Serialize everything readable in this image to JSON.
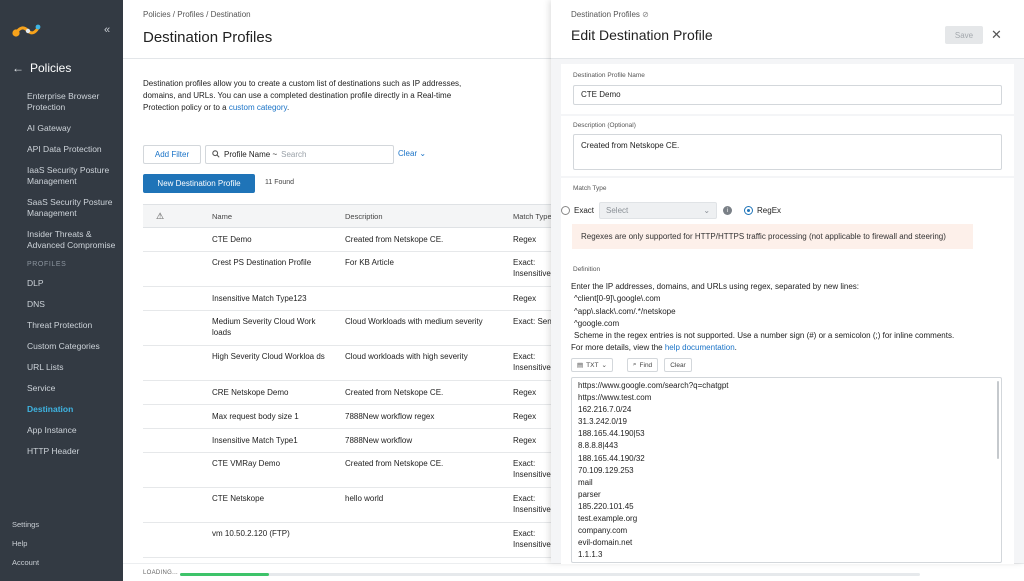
{
  "sidebar": {
    "back_title": "Policies",
    "items": [
      "Enterprise Browser Protection",
      "AI Gateway",
      "API Data Protection",
      "IaaS Security Posture Management",
      "SaaS Security Posture Management",
      "Insider Threats & Advanced Compromise"
    ],
    "section_label": "PROFILES",
    "profiles": [
      "DLP",
      "DNS",
      "Threat Protection",
      "Custom Categories",
      "URL Lists",
      "Service",
      "Destination",
      "App Instance",
      "HTTP Header"
    ],
    "active": "Destination",
    "bottom": [
      "Settings",
      "Help",
      "Account"
    ]
  },
  "main": {
    "breadcrumb": "Policies / Profiles / Destination",
    "title": "Destination Profiles",
    "intro_text": "Destination profiles allow you to create a custom list of destinations such as IP addresses, domains, and URLs. You can use a completed destination profile directly in a Real-time Protection policy or to a ",
    "intro_link": "custom category",
    "intro_end": ".",
    "add_filter": "Add Filter",
    "filter_label": "Profile Name ~",
    "filter_placeholder": "Search",
    "clear": "Clear",
    "new_button": "New Destination Profile",
    "found": "11 Found",
    "columns": {
      "warn": "⚠",
      "name": "Name",
      "description": "Description",
      "match": "Match Type"
    },
    "rows": [
      {
        "name": "CTE Demo",
        "desc": "Created from Netskope CE.",
        "match": "Regex"
      },
      {
        "name": "Crest PS Destination Profile",
        "desc": "For KB Article",
        "match": "Exact: Insensitive"
      },
      {
        "name": "Insensitive Match Type123",
        "desc": "",
        "match": "Regex"
      },
      {
        "name": "Medium Severity Cloud Work loads",
        "desc": "Cloud Workloads with medium severity",
        "match": "Exact: Sensitive"
      },
      {
        "name": "High Severity Cloud Workloa ds",
        "desc": "Cloud workloads with high severity",
        "match": "Exact: Insensitive"
      },
      {
        "name": "CRE Netskope Demo",
        "desc": "Created from Netskope CE.",
        "match": "Regex"
      },
      {
        "name": "Max request body size 1",
        "desc": "7888New workflow regex",
        "match": "Regex"
      },
      {
        "name": "Insensitive Match Type1",
        "desc": "7888New workflow",
        "match": "Regex"
      },
      {
        "name": "CTE VMRay Demo",
        "desc": "Created from Netskope CE.",
        "match": "Exact: Insensitive"
      },
      {
        "name": "CTE Netskope",
        "desc": "hello world",
        "match": "Exact: Insensitive"
      },
      {
        "name": "vm 10.50.2.120 (FTP)",
        "desc": "",
        "match": "Exact: Insensitive"
      }
    ]
  },
  "loading": {
    "label": "LOADING...",
    "progress": 0.12
  },
  "panel": {
    "breadcrumb": "Destination Profiles",
    "title": "Edit Destination Profile",
    "save": "Save",
    "name_label": "Destination Profile Name",
    "name_value": "CTE Demo",
    "desc_label": "Description (Optional)",
    "desc_value": "Created from Netskope CE.",
    "match_label": "Match Type",
    "exact_label": "Exact",
    "select_placeholder": "Select",
    "regex_label": "RegEx",
    "selected_match": "RegEx",
    "alert": "Regexes are only supported for HTTP/HTTPS traffic processing (not applicable to firewall and steering)",
    "def_label": "Definition",
    "def_intro": "Enter the IP addresses, domains, and URLs using regex, separated by new lines:",
    "def_examples": [
      "^client[0-9]\\.google\\.com",
      "^app\\.slack\\.com/.*/netskope",
      "^google.com"
    ],
    "def_scheme": "Scheme in the regex entries is not supported. Use a number sign (#) or a semicolon (;) for inline comments.",
    "def_more": "For more details, view the ",
    "def_link": "help documentation",
    "def_end": ".",
    "tool_txt": "TXT",
    "tool_find": "Find",
    "tool_clear": "Clear",
    "entries": [
      "https://www.google.com/search?q=chatgpt",
      "https://www.test.com",
      "162.216.7.0/24",
      "31.3.242.0/19",
      "188.165.44.190|53",
      "8.8.8.8|443",
      "188.165.44.190/32",
      "70.109.129.253",
      "mail",
      "parser",
      "185.220.101.45",
      "test.example.org",
      "company.com",
      "evil-domain.net",
      "1.1.1.3"
    ]
  }
}
